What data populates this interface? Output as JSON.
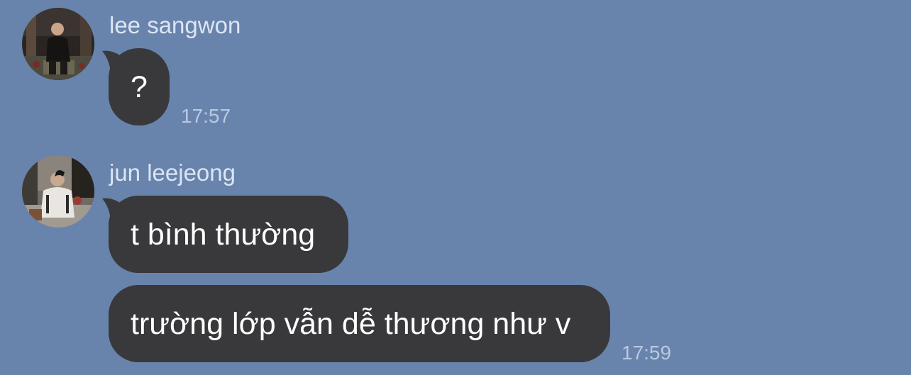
{
  "colors": {
    "background": "#6884ad",
    "bubble": "#39393b",
    "bubble_text": "#ffffff",
    "name_text": "#dce5f2",
    "time_text": "#b9c9df"
  },
  "messages": [
    {
      "sender": "lee sangwon",
      "avatar_icon": "user-avatar-photo",
      "bubbles": [
        "?"
      ],
      "time": "17:57"
    },
    {
      "sender": "jun leejeong",
      "avatar_icon": "user-avatar-photo",
      "bubbles": [
        "t bình thường",
        "trường lớp vẫn dễ thương như v"
      ],
      "time": "17:59"
    }
  ]
}
